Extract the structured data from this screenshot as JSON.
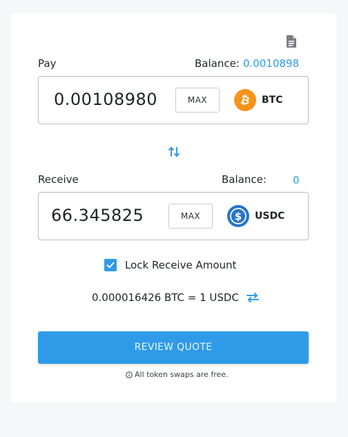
{
  "pay": {
    "label": "Pay",
    "balance_label": "Balance:",
    "balance_value": "0.0010898",
    "amount": "0.00108980",
    "max_label": "MAX",
    "token": "BTC",
    "token_icon": "bitcoin-icon"
  },
  "receive": {
    "label": "Receive",
    "balance_label": "Balance:",
    "balance_value": "0",
    "amount": "66.345825",
    "max_label": "MAX",
    "token": "USDC",
    "token_icon": "usdc-icon"
  },
  "lock": {
    "label": "Lock Receive Amount",
    "checked": true
  },
  "rate": {
    "text": "0.000016426 BTC = 1 USDC"
  },
  "review_button": {
    "label": "REVIEW QUOTE"
  },
  "note": {
    "text": "All token swaps are free."
  },
  "colors": {
    "accent": "#2f9be8",
    "bitcoin": "#f7931a",
    "usdc": "#2775ca"
  }
}
